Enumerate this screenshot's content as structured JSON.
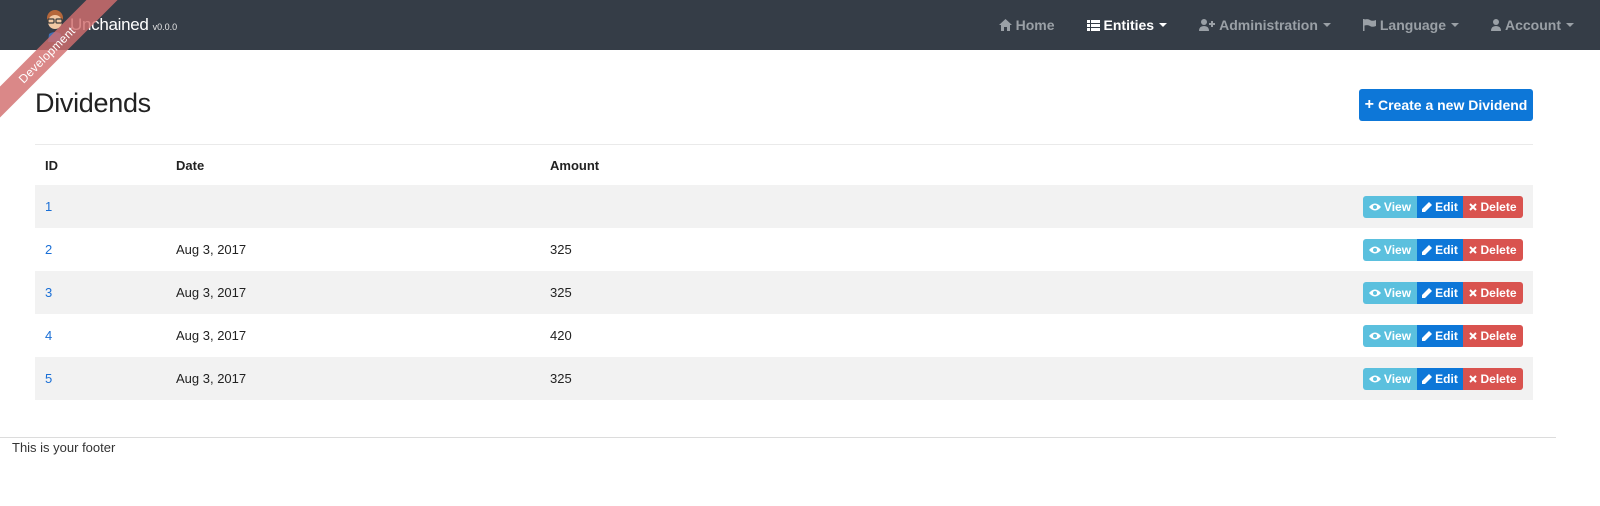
{
  "navbar": {
    "brand_name": "Unchained",
    "version": "v0.0.0",
    "ribbon": "Development",
    "items": [
      {
        "label": "Home",
        "icon": "home-icon",
        "active": false,
        "dropdown": false
      },
      {
        "label": "Entities",
        "icon": "list-icon",
        "active": true,
        "dropdown": true
      },
      {
        "label": "Administration",
        "icon": "user-plus-icon",
        "active": false,
        "dropdown": true
      },
      {
        "label": "Language",
        "icon": "flag-icon",
        "active": false,
        "dropdown": true
      },
      {
        "label": "Account",
        "icon": "user-icon",
        "active": false,
        "dropdown": true
      }
    ]
  },
  "page": {
    "title": "Dividends",
    "create_label": "Create a new Dividend"
  },
  "table": {
    "headers": {
      "id": "ID",
      "date": "Date",
      "amount": "Amount"
    },
    "actions": {
      "view": "View",
      "edit": "Edit",
      "delete": "Delete"
    },
    "rows": [
      {
        "id": "1",
        "date": "",
        "amount": ""
      },
      {
        "id": "2",
        "date": "Aug 3, 2017",
        "amount": "325"
      },
      {
        "id": "3",
        "date": "Aug 3, 2017",
        "amount": "325"
      },
      {
        "id": "4",
        "date": "Aug 3, 2017",
        "amount": "420"
      },
      {
        "id": "5",
        "date": "Aug 3, 2017",
        "amount": "325"
      }
    ]
  },
  "footer": {
    "text": "This is your footer"
  },
  "colors": {
    "navbar_bg": "#353d47",
    "primary": "#0d77d8",
    "info": "#5bc0de",
    "danger": "#d9534f",
    "ribbon": "#d26e6e"
  }
}
